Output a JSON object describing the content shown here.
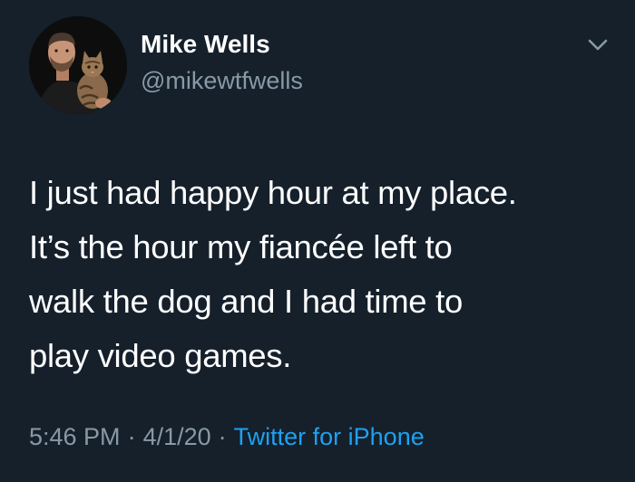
{
  "colors": {
    "background": "#15202b",
    "primary_text": "#ffffff",
    "secondary_text": "#8899a6",
    "link": "#1da1f2"
  },
  "author": {
    "display_name": "Mike Wells",
    "handle": "@mikewtfwells",
    "avatar_icon": "profile-photo-with-cat"
  },
  "menu": {
    "icon": "chevron-down-icon"
  },
  "tweet": {
    "lines": [
      "I just had happy hour at my place.",
      "It’s the hour my fiancée left to",
      "walk the dog and I had time to",
      "play video games."
    ]
  },
  "meta": {
    "time": "5:46 PM",
    "separator": "·",
    "date": "4/1/20",
    "source": "Twitter for iPhone"
  }
}
